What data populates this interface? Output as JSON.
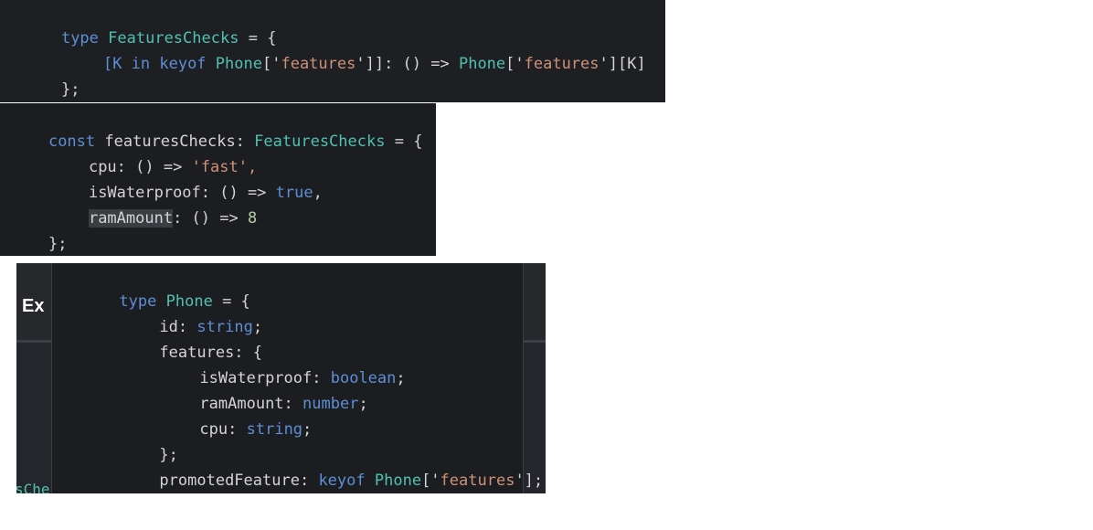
{
  "panel1": {
    "lines": [
      [
        "type",
        "FeaturesChecks",
        "=",
        "{"
      ],
      [
        "[K in keyof",
        "Phone",
        "['",
        "features",
        "']]: () =>",
        "Phone",
        "['",
        "features",
        "'][K]"
      ],
      [
        "};"
      ]
    ]
  },
  "panel2": {
    "lines": [
      [
        "const",
        "featuresChecks:",
        "FeaturesChecks",
        "= {"
      ],
      [
        "cpu: () =>",
        "'",
        "fast",
        "',"
      ],
      [
        "isWaterproof: () =>",
        "true",
        ","
      ],
      [
        "ramAmount",
        ": () =>",
        "8"
      ],
      [
        "};"
      ]
    ]
  },
  "panel3": {
    "background_text": {
      "left_label": "Ex",
      "bottom_left": "sChe"
    },
    "lines": [
      [
        "type",
        "Phone",
        "= {"
      ],
      [
        "id:",
        "string",
        ";"
      ],
      [
        "features: {"
      ],
      [
        "isWaterproof:",
        "boolean",
        ";"
      ],
      [
        "ramAmount:",
        "number",
        ";"
      ],
      [
        "cpu:",
        "string",
        ";"
      ],
      [
        "};"
      ],
      [
        "promotedFeature:",
        "keyof",
        "Phone",
        "['",
        "features",
        "'];"
      ],
      [
        "}"
      ]
    ]
  }
}
